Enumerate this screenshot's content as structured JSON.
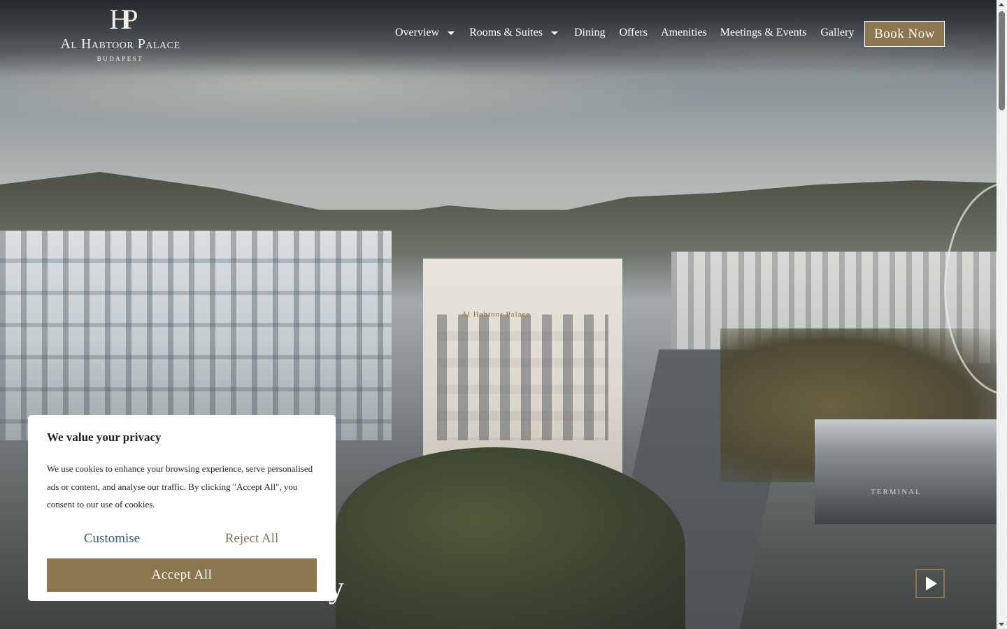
{
  "brand": {
    "monogram": "HP",
    "name": "Al Habtoor Palace",
    "city": "BUDAPEST"
  },
  "nav": {
    "items": [
      {
        "label": "Overview",
        "has_dropdown": true
      },
      {
        "label": "Rooms & Suites",
        "has_dropdown": true
      },
      {
        "label": "Dining",
        "has_dropdown": false
      },
      {
        "label": "Offers",
        "has_dropdown": false
      },
      {
        "label": "Amenities",
        "has_dropdown": false
      },
      {
        "label": "Meetings & Events",
        "has_dropdown": false
      },
      {
        "label": "Gallery",
        "has_dropdown": false
      }
    ],
    "book_label": "Book Now"
  },
  "hero": {
    "headline_fragment": "y",
    "building_sign": "Al Habtoor Palace",
    "terminal_sign": "TERMINAL",
    "play_icon": "play-icon"
  },
  "cookie": {
    "title": "We value your privacy",
    "body": "We use cookies to enhance your browsing experience, serve personalised ads or content, and analyse our traffic. By clicking \"Accept All\", you consent to our use of cookies.",
    "customise_label": "Customise",
    "reject_label": "Reject All",
    "accept_label": "Accept All"
  },
  "colors": {
    "accent": "#8a774f",
    "link": "#2c5f8a",
    "white": "#ffffff"
  }
}
